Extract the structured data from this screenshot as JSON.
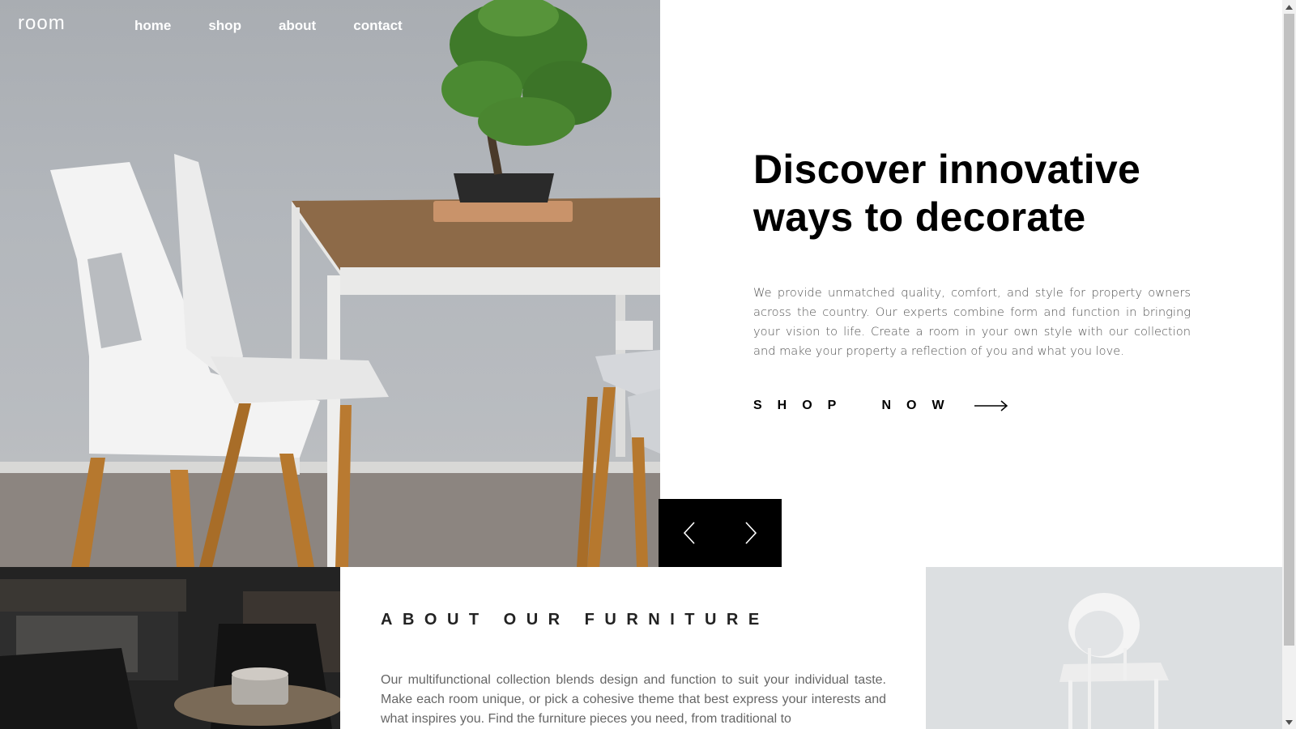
{
  "nav": {
    "logo": "room",
    "links": [
      {
        "label": "home"
      },
      {
        "label": "shop"
      },
      {
        "label": "about"
      },
      {
        "label": "contact"
      }
    ]
  },
  "hero": {
    "title_line1": "Discover innovative",
    "title_line2": "ways to decorate",
    "description": "We provide unmatched quality, comfort, and style for property owners across the country. Our experts combine form and function in bringing your vision to life. Create a room in your own style with our collection and make your property a reflection of you and what you love.",
    "cta_label": "SHOP NOW",
    "cta_icon": "arrow-right-icon"
  },
  "slider": {
    "prev_icon": "chevron-left-icon",
    "next_icon": "chevron-right-icon"
  },
  "about": {
    "heading": "ABOUT OUR FURNITURE",
    "text": "Our multifunctional collection blends design and function to suit your individual taste. Make each room unique, or pick a cohesive theme that best express your interests and what inspires you. Find the furniture pieces you need, from traditional to"
  },
  "colors": {
    "accent": "#000000",
    "body_text": "#555555",
    "background": "#ffffff"
  }
}
